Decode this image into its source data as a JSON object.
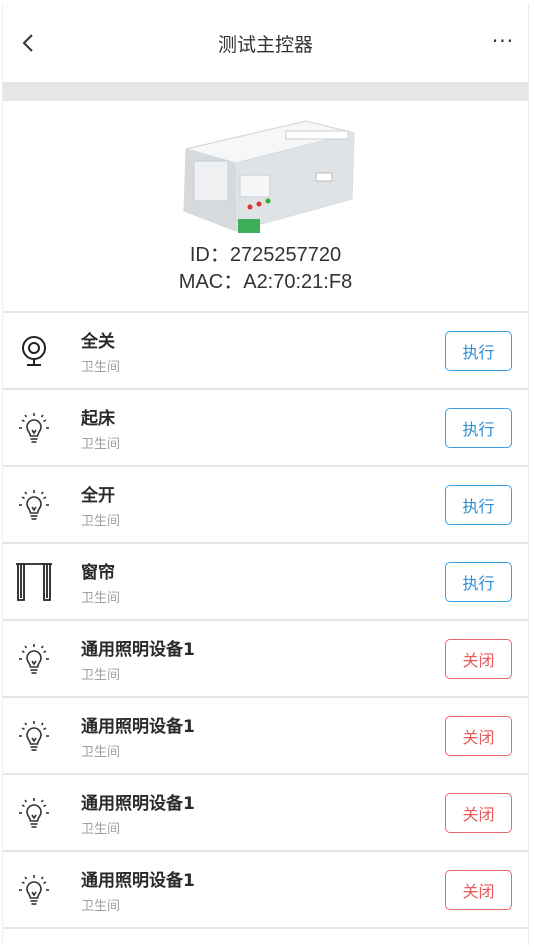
{
  "header": {
    "title": "测试主控器",
    "more_label": "···"
  },
  "device": {
    "id_line": "ID：2725257720",
    "mac_line": "MAC：A2:70:21:F8"
  },
  "scenes": [
    {
      "name": "全关",
      "room": "卫生间",
      "icon": "camera-icon",
      "action": "执行",
      "action_type": "exec"
    },
    {
      "name": "起床",
      "room": "卫生间",
      "icon": "bulb-icon",
      "action": "执行",
      "action_type": "exec"
    },
    {
      "name": "全开",
      "room": "卫生间",
      "icon": "bulb-icon",
      "action": "执行",
      "action_type": "exec"
    },
    {
      "name": "窗帘",
      "room": "卫生间",
      "icon": "curtain-icon",
      "action": "执行",
      "action_type": "exec"
    },
    {
      "name": "通用照明设备1",
      "room": "卫生间",
      "icon": "bulb-icon",
      "action": "关闭",
      "action_type": "off"
    },
    {
      "name": "通用照明设备1",
      "room": "卫生间",
      "icon": "bulb-icon",
      "action": "关闭",
      "action_type": "off"
    },
    {
      "name": "通用照明设备1",
      "room": "卫生间",
      "icon": "bulb-icon",
      "action": "关闭",
      "action_type": "off"
    },
    {
      "name": "通用照明设备1",
      "room": "卫生间",
      "icon": "bulb-icon",
      "action": "关闭",
      "action_type": "off"
    }
  ],
  "colors": {
    "exec": "#2d8ed6",
    "off": "#e55a5a",
    "divider": "#e6e6e6"
  }
}
